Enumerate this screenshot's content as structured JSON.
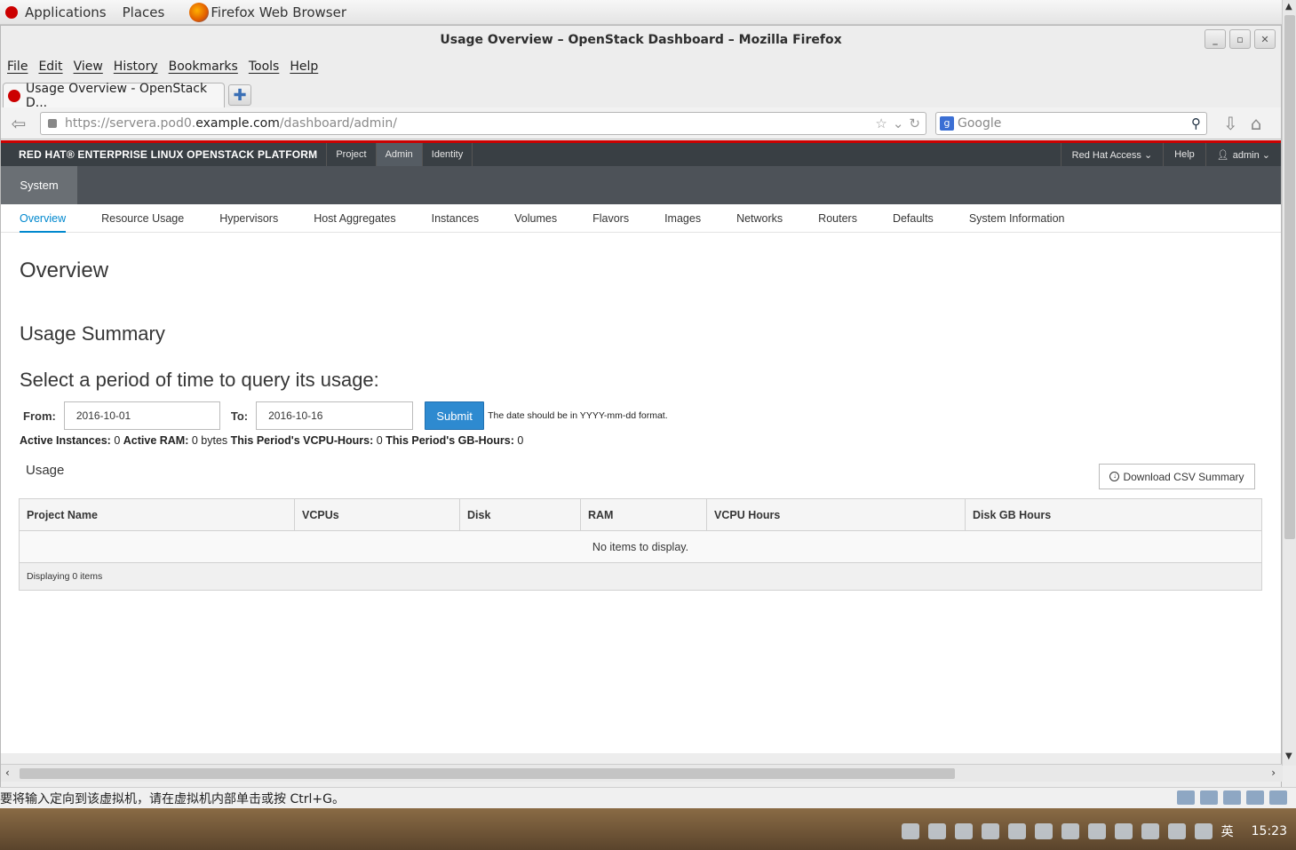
{
  "desktop": {
    "panel_items": [
      "Applications",
      "Places",
      "Firefox Web Browser"
    ],
    "clock": "15:23",
    "ime_indicator": "英"
  },
  "browser": {
    "window_title": "Usage Overview – OpenStack Dashboard – Mozilla Firefox",
    "menu": [
      "File",
      "Edit",
      "View",
      "History",
      "Bookmarks",
      "Tools",
      "Help"
    ],
    "tab_title": "Usage Overview - OpenStack D...",
    "url_prefix": "https://servera.pod0.",
    "url_domain": "example.com",
    "url_path": "/dashboard/admin/",
    "search_placeholder": "Google"
  },
  "dashboard": {
    "brand": "RED HAT® ENTERPRISE LINUX OPENSTACK PLATFORM",
    "top_tabs": [
      "Project",
      "Admin",
      "Identity"
    ],
    "right_menu": {
      "access": "Red Hat Access ⌄",
      "help": "Help",
      "user": "admin ⌄"
    },
    "panel_group": "System",
    "subnav": [
      "Overview",
      "Resource Usage",
      "Hypervisors",
      "Host Aggregates",
      "Instances",
      "Volumes",
      "Flavors",
      "Images",
      "Networks",
      "Routers",
      "Defaults",
      "System Information"
    ],
    "page_title": "Overview",
    "summary_title": "Usage Summary",
    "period_title": "Select a period of time to query its usage:",
    "form": {
      "from_label": "From:",
      "from_value": "2016-10-01",
      "to_label": "To:",
      "to_value": "2016-10-16",
      "submit": "Submit",
      "hint": "The date should be in YYYY-mm-dd format."
    },
    "stats": {
      "active_instances_label": "Active Instances:",
      "active_instances": "0",
      "active_ram_label": "Active RAM:",
      "active_ram": "0 bytes",
      "vcpu_hours_label": "This Period's VCPU-Hours:",
      "vcpu_hours": "0",
      "gb_hours_label": "This Period's GB-Hours:",
      "gb_hours": "0"
    },
    "usage_title": "Usage",
    "csv_button": "Download CSV Summary",
    "table": {
      "columns": [
        "Project Name",
        "VCPUs",
        "Disk",
        "RAM",
        "VCPU Hours",
        "Disk GB Hours"
      ],
      "empty_message": "No items to display.",
      "footer": "Displaying 0 items"
    }
  },
  "vm_status": "要将输入定向到该虚拟机，请在虚拟机内部单击或按 Ctrl+G。"
}
